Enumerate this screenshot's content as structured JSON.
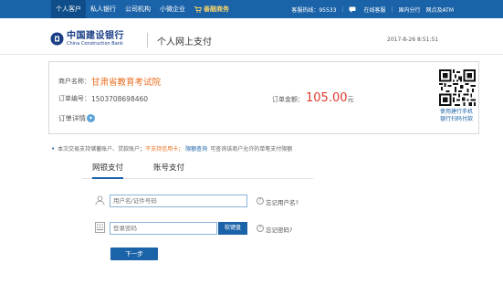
{
  "topbar": {
    "nav": [
      {
        "label": "个人客户",
        "active": true
      },
      {
        "label": "私人银行",
        "active": false
      },
      {
        "label": "公司机构",
        "active": false
      },
      {
        "label": "小微企业",
        "active": false
      }
    ],
    "badge": "善融商务",
    "hotline": "客服热线：95533",
    "chat": "在线客服",
    "branch": "国内分行",
    "atm": "网点及ATM"
  },
  "header": {
    "logo_cn": "中国建设银行",
    "logo_en": "China Construction Bank",
    "title": "个人网上支付",
    "datetime": "2017-8-26 8:51:51"
  },
  "order": {
    "merchant_label": "商户名称：",
    "merchant_name": "甘肃省教育考试院",
    "order_no_label": "订单编号：",
    "order_no": "1503708698460",
    "detail_label": "订单详情",
    "amount_label": "订单金额：",
    "amount": "105.00",
    "currency": "元",
    "qr_caption_1": "使用建行手机",
    "qr_caption_2": "银行扫码付款"
  },
  "notice": {
    "text_1": "本次交易支持储蓄账户、贷款账户；",
    "warn": "不支持信用卡；",
    "link": "限额查询",
    "text_2": "可查询该商户允许的单笔支付限额"
  },
  "tabs": [
    {
      "label": "网银支付",
      "active": true
    },
    {
      "label": "账号支付",
      "active": false
    }
  ],
  "form": {
    "user_placeholder": "用户名/证件号码",
    "forgot_user": "忘记用户名?",
    "pwd_placeholder": "登录密码",
    "keyboard": "软键盘",
    "forgot_pwd": "忘记密码?",
    "next": "下一步"
  },
  "colors": {
    "primary": "#1b63a8",
    "merchant": "#e96d1e",
    "amount": "#e03a2e"
  }
}
